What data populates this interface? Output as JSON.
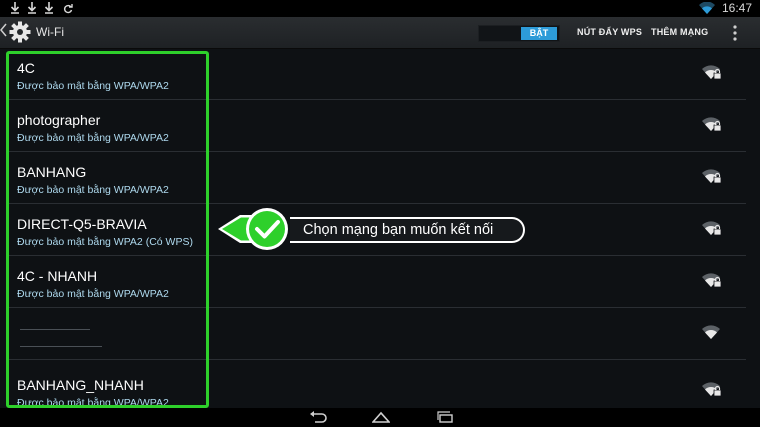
{
  "status_bar": {
    "time": "16:47",
    "icons": [
      "download-icon",
      "download-icon",
      "download-icon",
      "sync-icon",
      "wifi-status-icon"
    ]
  },
  "action_bar": {
    "title": "Wi-Fi",
    "toggle_label": "BẬT",
    "wps_button": "NÚT ĐẨY WPS",
    "add_network": "THÊM MẠNG"
  },
  "networks": [
    {
      "ssid": "4C",
      "security": "Được bảo mật bằng WPA/WPA2",
      "secured": true
    },
    {
      "ssid": "photographer",
      "security": "Được bảo mật bằng WPA/WPA2",
      "secured": true
    },
    {
      "ssid": "BANHANG",
      "security": "Được bảo mật bằng WPA/WPA2",
      "secured": true
    },
    {
      "ssid": "DIRECT-Q5-BRAVIA",
      "security": "Được bảo mật bằng WPA2 (Có WPS)",
      "secured": true
    },
    {
      "ssid": "4C - NHANH",
      "security": "Được bảo mật bằng WPA/WPA2",
      "secured": true
    },
    {
      "ssid": "",
      "security": "",
      "secured": false
    },
    {
      "ssid": "BANHANG_NHANH",
      "security": "Được bảo mật bằng WPA/WPA2",
      "secured": true
    }
  ],
  "annotation": {
    "text": "Chọn mạng bạn muốn kết nối",
    "highlight_color": "#2ed02b"
  },
  "colors": {
    "accent": "#2d9bd8",
    "subtitle": "#aed9ee",
    "highlight": "#2ed02b"
  },
  "nav_bar": {
    "icons": [
      "back-icon",
      "home-icon",
      "recent-apps-icon"
    ]
  }
}
